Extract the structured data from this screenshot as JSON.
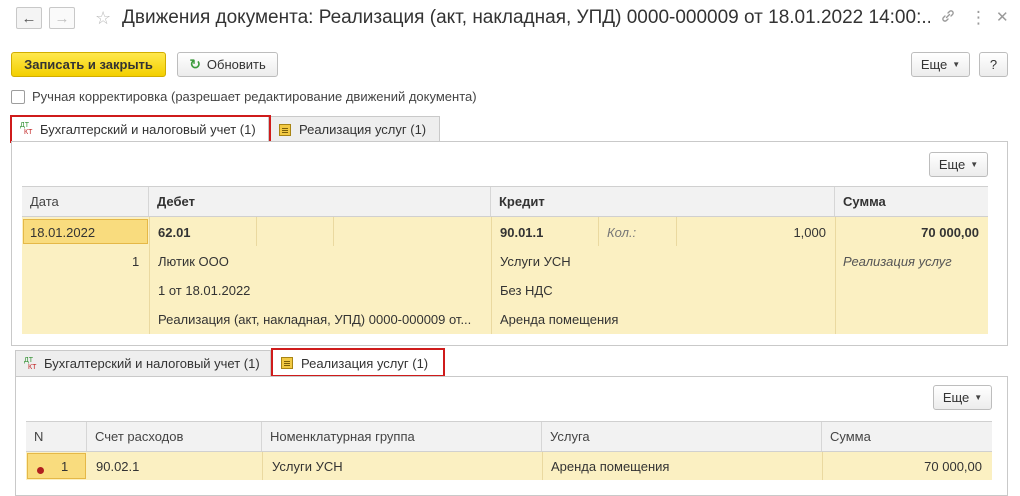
{
  "window": {
    "title": "Движения документа: Реализация (акт, накладная, УПД) 0000-000009 от 18.01.2022 14:00:...",
    "icons": [
      "back-arrow-icon",
      "forward-arrow-icon",
      "star-icon",
      "link-icon",
      "more-vert-icon",
      "close-icon"
    ],
    "back_glyph": "←",
    "forward_glyph": "→",
    "star_glyph": "☆",
    "link_glyph": "🔗",
    "more_glyph": "⋮",
    "close_glyph": "✕"
  },
  "toolbar": {
    "save_close_label": "Записать и закрыть",
    "refresh_label": "Обновить",
    "refresh_glyph": "↻",
    "more_label": "Еще",
    "help_label": "?"
  },
  "manual_correction": {
    "label": "Ручная корректировка (разрешает редактирование движений документа)",
    "checked": false
  },
  "tabs_top": [
    {
      "label": "Бухгалтерский и налоговый учет (1)",
      "active": true,
      "icon": "dt-kt-icon"
    },
    {
      "label": "Реализация услуг (1)",
      "active": false,
      "icon": "register-icon"
    }
  ],
  "icon_text": {
    "dt": "ДТ",
    "kt": "КТ"
  },
  "accounting": {
    "more_label": "Еще",
    "columns": [
      "Дата",
      "Дебет",
      "Кредит",
      "Сумма"
    ],
    "row": {
      "date": "18.01.2022",
      "number": "1",
      "debit": {
        "account": "62.01",
        "subconto1": "Лютик ООО",
        "subconto2": "1 от 18.01.2022",
        "subconto3": "Реализация (акт, накладная, УПД) 0000-000009 от..."
      },
      "credit": {
        "account": "90.01.1",
        "qty_label": "Кол.:",
        "qty": "1,000",
        "subconto1": "Услуги УСН",
        "subconto2": "Без НДС",
        "subconto3": "Аренда помещения"
      },
      "amount": "70 000,00",
      "content": "Реализация услуг"
    }
  },
  "tabs_bottom": [
    {
      "label": "Бухгалтерский и налоговый учет (1)",
      "active": false,
      "icon": "dt-kt-icon"
    },
    {
      "label": "Реализация услуг (1)",
      "active": true,
      "icon": "register-icon"
    }
  ],
  "services": {
    "more_label": "Еще",
    "columns": [
      "N",
      "Счет расходов",
      "Номенклатурная группа",
      "Услуга",
      "Сумма"
    ],
    "rows": [
      {
        "n": "1",
        "account": "90.02.1",
        "group": "Услуги УСН",
        "service": "Аренда помещения",
        "amount": "70 000,00"
      }
    ]
  },
  "colors": {
    "highlight_border": "#cf1b1b",
    "selected_row": "#fbf0c2",
    "primary_button": "#f3cf00"
  }
}
